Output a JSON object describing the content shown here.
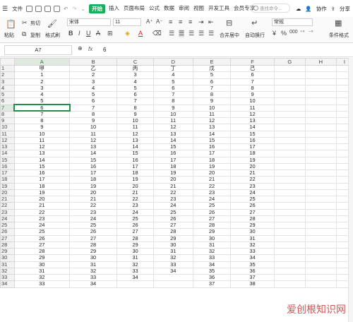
{
  "menubar": {
    "file_label": "文件",
    "tabs": [
      "开始",
      "插入",
      "页面布局",
      "公式",
      "数据",
      "审阅",
      "视图",
      "开发工具",
      "会员专享"
    ],
    "active_tab": "开始",
    "search_placeholder": "查找命令...",
    "collab_label": "协作",
    "share_label": "分享"
  },
  "ribbon": {
    "paste_label": "粘贴",
    "cut_label": "剪切",
    "copy_label": "复制",
    "format_painter_label": "格式刷",
    "font_name": "宋体",
    "font_size": "11",
    "merge_center_label": "合并居中",
    "wrap_text_label": "自动换行",
    "number_format": "常规",
    "conditional_format_label": "条件格式"
  },
  "formula_bar": {
    "name_box": "A7",
    "fx_label": "fx",
    "value": "6"
  },
  "grid": {
    "columns": [
      "A",
      "B",
      "C",
      "D",
      "E",
      "F",
      "G",
      "H",
      "I"
    ],
    "col_widths": [
      82,
      70,
      54,
      58,
      56,
      64,
      46,
      46,
      24
    ],
    "selected_col": "A",
    "selected_row": 7,
    "rows": [
      [
        "甲",
        "乙",
        "丙",
        "丁",
        "戊",
        "己"
      ],
      [
        "1",
        "2",
        "3",
        "4",
        "5",
        "6"
      ],
      [
        "2",
        "3",
        "4",
        "5",
        "6",
        "7"
      ],
      [
        "3",
        "4",
        "5",
        "6",
        "7",
        "8"
      ],
      [
        "4",
        "5",
        "6",
        "7",
        "8",
        "9"
      ],
      [
        "5",
        "6",
        "7",
        "8",
        "9",
        "10"
      ],
      [
        "6",
        "7",
        "8",
        "9",
        "10",
        "11"
      ],
      [
        "7",
        "8",
        "9",
        "10",
        "11",
        "12"
      ],
      [
        "8",
        "9",
        "10",
        "11",
        "12",
        "13"
      ],
      [
        "9",
        "10",
        "11",
        "12",
        "13",
        "14"
      ],
      [
        "10",
        "11",
        "12",
        "13",
        "14",
        "15"
      ],
      [
        "11",
        "12",
        "13",
        "14",
        "15",
        "16"
      ],
      [
        "12",
        "13",
        "14",
        "15",
        "16",
        "17"
      ],
      [
        "13",
        "14",
        "15",
        "16",
        "17",
        "18"
      ],
      [
        "14",
        "15",
        "16",
        "17",
        "18",
        "19"
      ],
      [
        "15",
        "16",
        "17",
        "18",
        "19",
        "20"
      ],
      [
        "16",
        "17",
        "18",
        "19",
        "20",
        "21"
      ],
      [
        "17",
        "18",
        "19",
        "20",
        "21",
        "22"
      ],
      [
        "18",
        "19",
        "20",
        "21",
        "22",
        "23"
      ],
      [
        "19",
        "20",
        "21",
        "22",
        "23",
        "24"
      ],
      [
        "20",
        "21",
        "22",
        "23",
        "24",
        "25"
      ],
      [
        "21",
        "22",
        "23",
        "24",
        "25",
        "26"
      ],
      [
        "22",
        "23",
        "24",
        "25",
        "26",
        "27"
      ],
      [
        "23",
        "24",
        "25",
        "26",
        "27",
        "28"
      ],
      [
        "24",
        "25",
        "26",
        "27",
        "28",
        "29"
      ],
      [
        "25",
        "26",
        "27",
        "28",
        "29",
        "30"
      ],
      [
        "26",
        "27",
        "28",
        "29",
        "30",
        "31"
      ],
      [
        "27",
        "28",
        "29",
        "30",
        "31",
        "32"
      ],
      [
        "28",
        "29",
        "30",
        "31",
        "32",
        "33"
      ],
      [
        "29",
        "30",
        "31",
        "32",
        "33",
        "34"
      ],
      [
        "30",
        "31",
        "32",
        "33",
        "34",
        "35"
      ],
      [
        "31",
        "32",
        "33",
        "34",
        "35",
        "36"
      ],
      [
        "32",
        "33",
        "34",
        "",
        "36",
        "37"
      ],
      [
        "33",
        "34",
        "",
        "",
        "37",
        "38"
      ]
    ]
  },
  "watermark": "爱创根知识网",
  "colors": {
    "accent": "#1aad5c",
    "selection": "#1f8f4a"
  }
}
